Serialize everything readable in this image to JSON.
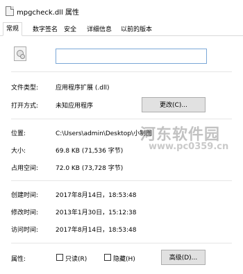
{
  "window": {
    "title": "mpgcheck.dll 属性"
  },
  "tabs": [
    {
      "label": "常规"
    },
    {
      "label": "数字签名"
    },
    {
      "label": "安全"
    },
    {
      "label": "详细信息"
    },
    {
      "label": "以前的版本"
    }
  ],
  "general": {
    "file_name_value": "",
    "type_label": "文件类型:",
    "type_value": "应用程序扩展 (.dll)",
    "open_with_label": "打开方式:",
    "open_with_value": "未知应用程序",
    "change_button": "更改(C)...",
    "location_label": "位置:",
    "location_value": "C:\\Users\\admin\\Desktop\\小制图",
    "size_label": "大小:",
    "size_value": "69.8 KB (71,536 字节)",
    "size_on_disk_label": "占用空间:",
    "size_on_disk_value": "72.0 KB (73,728 字节)",
    "created_label": "创建时间:",
    "created_value": "2017年8月14日，18:53:48",
    "modified_label": "修改时间:",
    "modified_value": "2013年1月30日，15:12:38",
    "accessed_label": "访问时间:",
    "accessed_value": "2017年8月14日，18:53:48",
    "attributes_label": "属性:",
    "readonly_label": "只读(R)",
    "hidden_label": "隐藏(H)",
    "advanced_button": "高级(D)..."
  },
  "watermark": {
    "line1": "河东软件园",
    "line2": "www.pc0359.cn"
  }
}
